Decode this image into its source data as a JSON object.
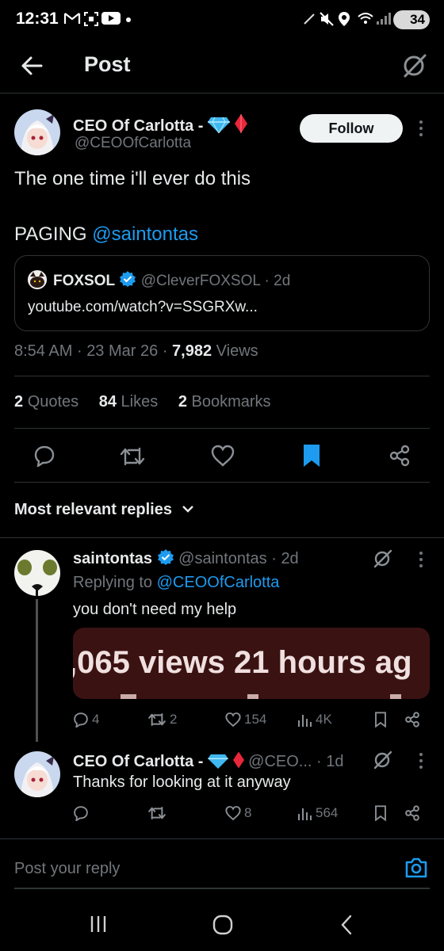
{
  "status_bar": {
    "time": "12:31",
    "battery": "34"
  },
  "header": {
    "title": "Post"
  },
  "post": {
    "author_name": "CEO Of Carlotta -",
    "author_handle": "@CEOOfCarlotta",
    "follow_label": "Follow",
    "text_line1": "The one time i'll ever do this",
    "text_line2_prefix": "PAGING",
    "mention": "@saintontas",
    "quote": {
      "author_name": "FOXSOL",
      "author_handle": "@CleverFOXSOL",
      "sep": "·",
      "age": "2d",
      "link": "youtube.com/watch?v=SSGRXw..."
    },
    "meta": {
      "time": "8:54 AM",
      "sep1": "·",
      "date": "23 Mar 26",
      "sep2": "·",
      "views_count": "7,982",
      "views_label": "Views"
    },
    "stats": {
      "quotes_count": "2",
      "quotes_label": "Quotes",
      "likes_count": "84",
      "likes_label": "Likes",
      "bookmarks_count": "2",
      "bookmarks_label": "Bookmarks"
    }
  },
  "replies_sort": {
    "label": "Most relevant replies"
  },
  "reply1": {
    "author_name": "saintontas",
    "author_handle": "@saintontas",
    "sep": "·",
    "age": "2d",
    "replying_prefix": "Replying to",
    "replying_to": "@CEOOfCarlotta",
    "text": "you don't need my help",
    "media_text": ",065 views  21 hours ag",
    "actions": {
      "replies": "4",
      "reposts": "2",
      "likes": "154",
      "views": "4K"
    }
  },
  "reply2": {
    "author_name": "CEO Of Carlotta -",
    "author_handle": "@CEO...",
    "sep": "·",
    "age": "1d",
    "text": "Thanks for looking at it anyway",
    "actions": {
      "likes": "8",
      "views": "564"
    }
  },
  "composer": {
    "placeholder": "Post your reply"
  },
  "colors": {
    "accent": "#1d9bf0",
    "muted": "#71767b",
    "background": "#000000",
    "text": "#e7e9ea",
    "diamond_blue": "#3fb8f0",
    "diamond_red": "#e8273b"
  }
}
